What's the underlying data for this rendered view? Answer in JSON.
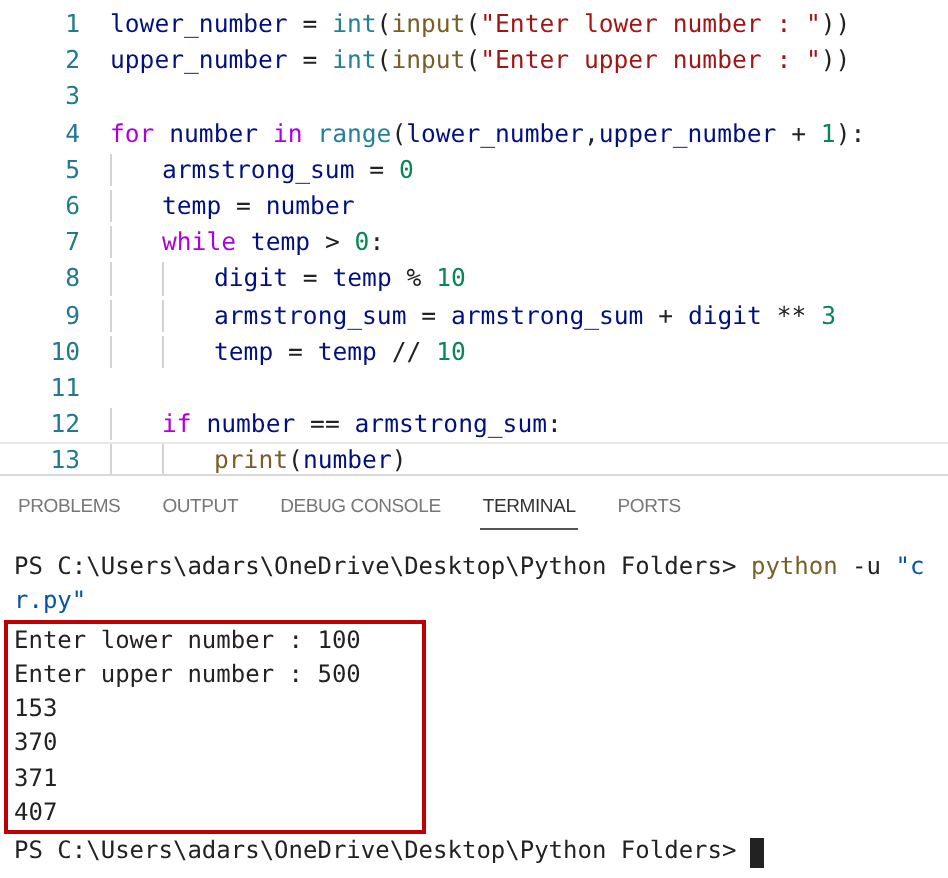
{
  "editor": {
    "lines": [
      {
        "number": "1",
        "current": false,
        "tokens": [
          {
            "kind": "var",
            "text": "lower_number"
          },
          {
            "kind": "op",
            "text": " = "
          },
          {
            "kind": "cls",
            "text": "int"
          },
          {
            "kind": "op",
            "text": "("
          },
          {
            "kind": "fn",
            "text": "input"
          },
          {
            "kind": "op",
            "text": "("
          },
          {
            "kind": "str",
            "text": "\"Enter lower number : \""
          },
          {
            "kind": "op",
            "text": "))"
          }
        ]
      },
      {
        "number": "2",
        "current": false,
        "tokens": [
          {
            "kind": "var",
            "text": "upper_number"
          },
          {
            "kind": "op",
            "text": " = "
          },
          {
            "kind": "cls",
            "text": "int"
          },
          {
            "kind": "op",
            "text": "("
          },
          {
            "kind": "fn",
            "text": "input"
          },
          {
            "kind": "op",
            "text": "("
          },
          {
            "kind": "str",
            "text": "\"Enter upper number : \""
          },
          {
            "kind": "op",
            "text": "))"
          }
        ]
      },
      {
        "number": "3",
        "current": false
      },
      {
        "number": "4",
        "current": false,
        "tokens": [
          {
            "kind": "kw",
            "text": "for"
          },
          {
            "kind": "var",
            "text": " number "
          },
          {
            "kind": "kw",
            "text": "in"
          },
          {
            "kind": "cls",
            "text": " range"
          },
          {
            "kind": "op",
            "text": "("
          },
          {
            "kind": "var",
            "text": "lower_number"
          },
          {
            "kind": "op",
            "text": ","
          },
          {
            "kind": "var",
            "text": "upper_number"
          },
          {
            "kind": "op",
            "text": " + "
          },
          {
            "kind": "num",
            "text": "1"
          },
          {
            "kind": "op",
            "text": "):"
          }
        ],
        "children": [
          {
            "number": "5",
            "current": false,
            "tokens": [
              {
                "kind": "var",
                "text": "armstrong_sum"
              },
              {
                "kind": "op",
                "text": " = "
              },
              {
                "kind": "num",
                "text": "0"
              }
            ]
          },
          {
            "number": "6",
            "current": false,
            "tokens": [
              {
                "kind": "var",
                "text": "temp"
              },
              {
                "kind": "op",
                "text": " = "
              },
              {
                "kind": "var",
                "text": "number"
              }
            ]
          },
          {
            "number": "7",
            "current": false,
            "tokens": [
              {
                "kind": "kw",
                "text": "while"
              },
              {
                "kind": "var",
                "text": " temp"
              },
              {
                "kind": "op",
                "text": " > "
              },
              {
                "kind": "num",
                "text": "0"
              },
              {
                "kind": "op",
                "text": ":"
              }
            ],
            "children": [
              {
                "number": "8",
                "current": false,
                "tokens": [
                  {
                    "kind": "var",
                    "text": "digit"
                  },
                  {
                    "kind": "op",
                    "text": " = "
                  },
                  {
                    "kind": "var",
                    "text": "temp"
                  },
                  {
                    "kind": "op",
                    "text": " % "
                  },
                  {
                    "kind": "num",
                    "text": "10"
                  }
                ]
              },
              {
                "number": "9",
                "current": false,
                "tokens": [
                  {
                    "kind": "var",
                    "text": "armstrong_sum"
                  },
                  {
                    "kind": "op",
                    "text": " = "
                  },
                  {
                    "kind": "var",
                    "text": "armstrong_sum"
                  },
                  {
                    "kind": "op",
                    "text": " + "
                  },
                  {
                    "kind": "var",
                    "text": "digit"
                  },
                  {
                    "kind": "op",
                    "text": " ** "
                  },
                  {
                    "kind": "num",
                    "text": "3"
                  }
                ]
              },
              {
                "number": "10",
                "current": false,
                "tokens": [
                  {
                    "kind": "var",
                    "text": "temp"
                  },
                  {
                    "kind": "op",
                    "text": " = "
                  },
                  {
                    "kind": "var",
                    "text": "temp"
                  },
                  {
                    "kind": "op",
                    "text": " // "
                  },
                  {
                    "kind": "num",
                    "text": "10"
                  }
                ]
              }
            ]
          },
          {
            "number": "11",
            "current": false
          },
          {
            "number": "12",
            "current": false,
            "tokens": [
              {
                "kind": "kw",
                "text": "if"
              },
              {
                "kind": "var",
                "text": " number"
              },
              {
                "kind": "op",
                "text": " == "
              },
              {
                "kind": "var",
                "text": "armstrong_sum"
              },
              {
                "kind": "op",
                "text": ":"
              }
            ],
            "children": [
              {
                "number": "13",
                "current": true,
                "tokens": [
                  {
                    "kind": "fn",
                    "text": "print"
                  },
                  {
                    "kind": "op",
                    "text": "("
                  },
                  {
                    "kind": "var",
                    "text": "number"
                  },
                  {
                    "kind": "op",
                    "text": ")"
                  }
                ]
              }
            ]
          }
        ]
      }
    ]
  },
  "panel": {
    "tabs": [
      {
        "label": "PROBLEMS",
        "selected": false
      },
      {
        "label": "OUTPUT",
        "selected": false
      },
      {
        "label": "DEBUG CONSOLE",
        "selected": false
      },
      {
        "label": "TERMINAL",
        "selected": true
      },
      {
        "label": "PORTS",
        "selected": false
      }
    ]
  },
  "terminal": {
    "cursor": true,
    "lines": [
      {
        "highlighted": false,
        "tokens": [
          {
            "kind": "op",
            "text": "PS C:\\Users\\adars\\OneDrive\\Desktop\\Python Folders> "
          },
          {
            "kind": "fn",
            "text": "python"
          },
          {
            "kind": "op",
            "text": " -u "
          },
          {
            "kind": "path",
            "text": "\"c"
          }
        ]
      },
      {
        "highlighted": false,
        "tokens": [
          {
            "kind": "path",
            "text": "r.py\""
          }
        ]
      },
      {
        "highlighted": true,
        "tokens": [
          {
            "kind": "op",
            "text": "Enter lower number : 100"
          }
        ]
      },
      {
        "highlighted": true,
        "tokens": [
          {
            "kind": "op",
            "text": "Enter upper number : 500"
          }
        ]
      },
      {
        "highlighted": true,
        "tokens": [
          {
            "kind": "op",
            "text": "153"
          }
        ]
      },
      {
        "highlighted": true,
        "tokens": [
          {
            "kind": "op",
            "text": "370"
          }
        ]
      },
      {
        "highlighted": true,
        "tokens": [
          {
            "kind": "op",
            "text": "371"
          }
        ]
      },
      {
        "highlighted": true,
        "tokens": [
          {
            "kind": "op",
            "text": "407"
          }
        ]
      },
      {
        "highlighted": false,
        "tokens": [
          {
            "kind": "op",
            "text": "PS C:\\Users\\adars\\OneDrive\\Desktop\\Python Folders> "
          }
        ]
      }
    ]
  }
}
